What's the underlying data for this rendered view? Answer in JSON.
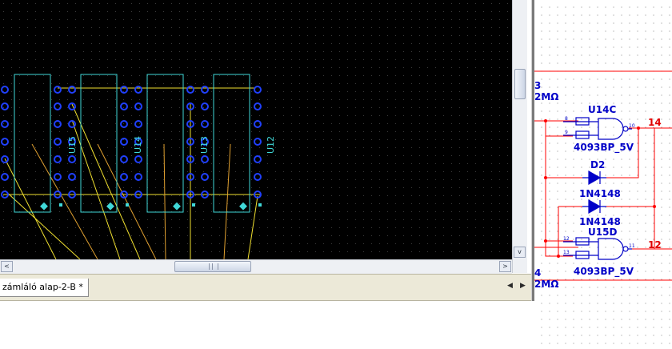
{
  "pcb": {
    "parts": [
      {
        "ref": "U15"
      },
      {
        "ref": "U14"
      },
      {
        "ref": "U13"
      },
      {
        "ref": "U12"
      }
    ]
  },
  "tabs": {
    "active_label": "zámláló alap-2-B *",
    "nav_left": "◀",
    "nav_right": "▶"
  },
  "scroll": {
    "left_arrow": "<",
    "right_arrow": ">",
    "up_arrow": "^",
    "down_arrow": "v"
  },
  "schematic": {
    "partial_top_ref": "3",
    "partial_top_value": "2MΩ",
    "gate1": {
      "ref": "U14C",
      "model": "4093BP_5V",
      "pin_a": "8",
      "pin_b": "9",
      "pin_out": "10"
    },
    "net_top": "14",
    "diode1": {
      "ref": "D2",
      "model": "1N4148"
    },
    "diode2": {
      "ref": "D1",
      "model": "1N4148"
    },
    "gate2": {
      "ref": "U15D",
      "model": "4093BP_5V",
      "pin_a": "12",
      "pin_b": "13",
      "pin_out": "11"
    },
    "net_bottom": "12",
    "partial_bottom_ref": "4",
    "partial_bottom_value": "2MΩ",
    "colors": {
      "wire": "#ff0000",
      "component": "#0000c8",
      "net_label": "#e00000"
    }
  }
}
